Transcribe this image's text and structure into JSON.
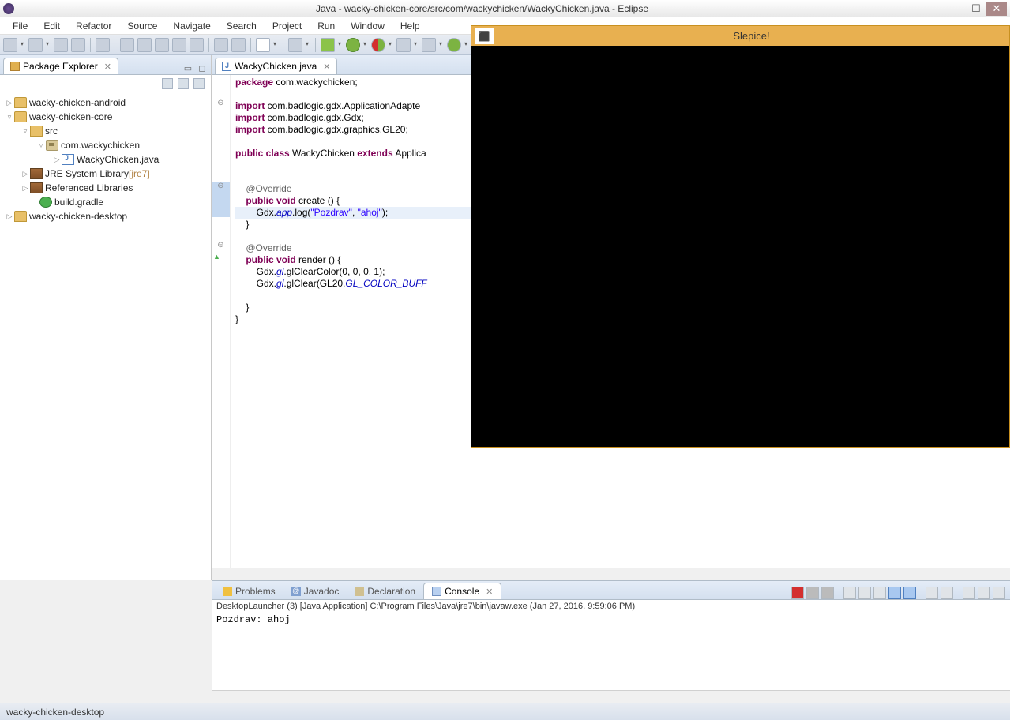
{
  "title": "Java - wacky-chicken-core/src/com/wackychicken/WackyChicken.java - Eclipse",
  "menu": {
    "file": "File",
    "edit": "Edit",
    "refactor": "Refactor",
    "source": "Source",
    "navigate": "Navigate",
    "search": "Search",
    "project": "Project",
    "run": "Run",
    "window": "Window",
    "help": "Help"
  },
  "package_explorer": {
    "title": "Package Explorer",
    "tree": {
      "wca": "wacky-chicken-android",
      "wcc": "wacky-chicken-core",
      "src": "src",
      "pkg": "com.wackychicken",
      "file": "WackyChicken.java",
      "jre": "JRE System Library",
      "jre_dec": "[jre7]",
      "reflib": "Referenced Libraries",
      "gradle": "build.gradle",
      "wcd": "wacky-chicken-desktop"
    }
  },
  "editor": {
    "tab": "WackyChicken.java",
    "code": {
      "l1a": "package",
      "l1b": " com.wackychicken;",
      "l3a": "import",
      "l3b": " com.badlogic.gdx.ApplicationAdapte",
      "l4a": "import",
      "l4b": " com.badlogic.gdx.Gdx;",
      "l5a": "import",
      "l5b": " com.badlogic.gdx.graphics.GL20;",
      "l7a": "public class",
      "l7b": " WackyChicken ",
      "l7c": "extends",
      "l7d": " Applica",
      "l9": "    @Override",
      "l10a": "    public void",
      "l10b": " create () {",
      "l11a": "        Gdx.",
      "l11b": "app",
      "l11c": ".log(",
      "l11d": "\"Pozdrav\"",
      "l11e": ", ",
      "l11f": "\"ahoj\"",
      "l11g": ");",
      "l12": "    }",
      "l14": "    @Override",
      "l15a": "    public void",
      "l15b": " render () {",
      "l16a": "        Gdx.",
      "l16b": "gl",
      "l16c": ".glClearColor(0, 0, 0, 1);",
      "l17a": "        Gdx.",
      "l17b": "gl",
      "l17c": ".glClear(GL20.",
      "l17d": "GL_COLOR_BUFF",
      "l19": "    }",
      "l20": "}"
    }
  },
  "bottom": {
    "problems": "Problems",
    "javadoc": "Javadoc",
    "declaration": "Declaration",
    "console": "Console",
    "launch_info": "DesktopLauncher (3) [Java Application] C:\\Program Files\\Java\\jre7\\bin\\javaw.exe (Jan 27, 2016, 9:59:06 PM)",
    "output": "Pozdrav: ahoj"
  },
  "floatwin": {
    "title": "Slepice!",
    "icon": "⬛"
  },
  "statusbar": "wacky-chicken-desktop"
}
